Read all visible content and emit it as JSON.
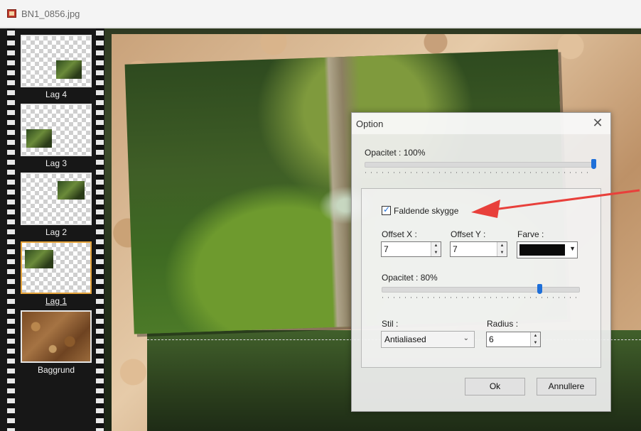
{
  "window": {
    "title": "BN1_0856.jpg",
    "icon": "image-file-icon"
  },
  "layers": [
    {
      "label": "Lag 4",
      "selected": false
    },
    {
      "label": "Lag 3",
      "selected": false
    },
    {
      "label": "Lag 2",
      "selected": false
    },
    {
      "label": "Lag 1",
      "selected": true
    },
    {
      "label": "Baggrund",
      "selected": false
    }
  ],
  "dialog": {
    "title": "Option",
    "close_icon": "close-icon",
    "opacity_label": "Opacitet : 100%",
    "opacity_value": 100,
    "shadow": {
      "checkbox_label": "Faldende skygge",
      "checked": true,
      "offset_x_label": "Offset X :",
      "offset_x_value": "7",
      "offset_y_label": "Offset Y :",
      "offset_y_value": "7",
      "color_label": "Farve :",
      "color_value": "#0a0a0a",
      "opacity_label": "Opacitet : 80%",
      "opacity_value": 80,
      "style_label": "Stil :",
      "style_value": "Antialiased",
      "radius_label": "Radius :",
      "radius_value": "6"
    },
    "ok_label": "Ok",
    "cancel_label": "Annullere"
  },
  "annotation": {
    "arrow_color": "#e8403b"
  }
}
